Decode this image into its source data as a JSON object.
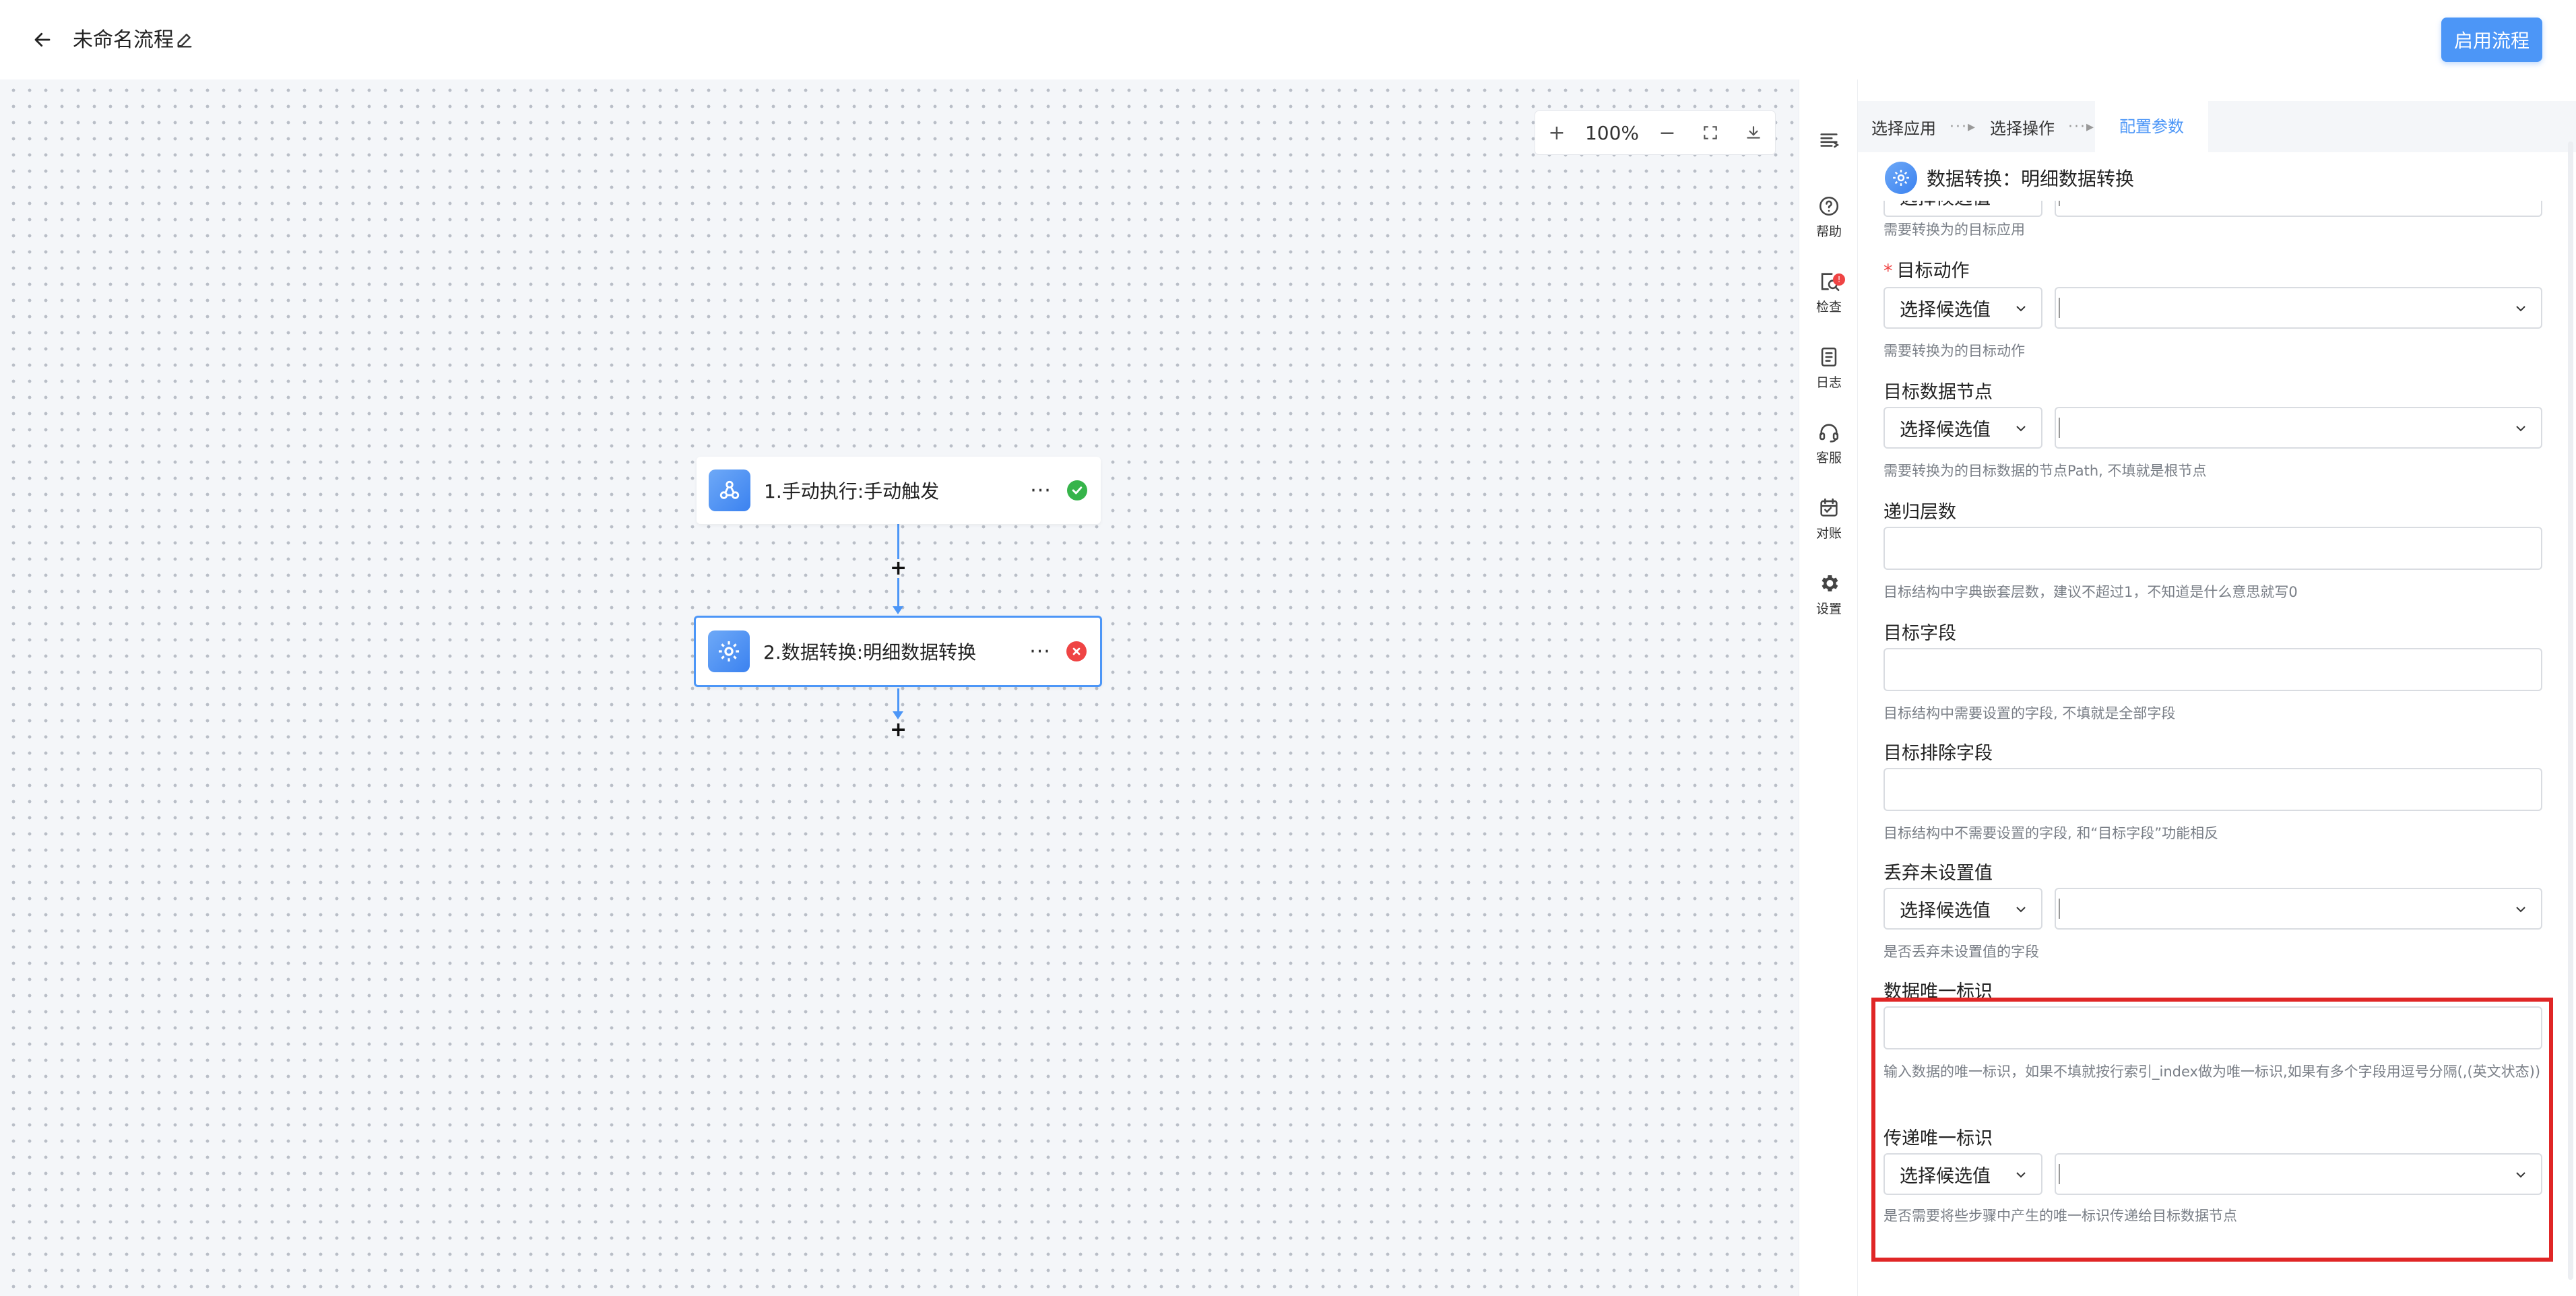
{
  "header": {
    "title": "未命名流程",
    "enable_button": "启用流程"
  },
  "canvas": {
    "zoom": "100%",
    "zoom_in": "+",
    "zoom_out": "−",
    "nodes": [
      {
        "label": "1.手动执行:手动触发",
        "more": "···",
        "status": "success"
      },
      {
        "label": "2.数据转换:明细数据转换",
        "more": "···",
        "status": "error"
      }
    ],
    "add_step": "+"
  },
  "rail": {
    "items": [
      {
        "label": "",
        "icon": "menu-icon"
      },
      {
        "label": "帮助",
        "icon": "help-icon"
      },
      {
        "label": "检查",
        "icon": "check-icon",
        "badge": "!"
      },
      {
        "label": "日志",
        "icon": "log-icon"
      },
      {
        "label": "客服",
        "icon": "headset-icon"
      },
      {
        "label": "对账",
        "icon": "calendar-icon"
      },
      {
        "label": "设置",
        "icon": "gear-icon"
      }
    ]
  },
  "panel": {
    "steps": [
      "选择应用",
      "选择操作",
      "配置参数"
    ],
    "step_separator": "···▸",
    "title": "数据转换：明细数据转换",
    "select_placeholder": "选择候选值",
    "fields": [
      {
        "hint": "需要转换为的目标应用"
      },
      {
        "label": "目标动作",
        "required": true,
        "hint": "需要转换为的目标动作"
      },
      {
        "label": "目标数据节点",
        "hint": "需要转换为的目标数据的节点Path, 不填就是根节点"
      },
      {
        "label": "递归层数",
        "hint": "目标结构中字典嵌套层数，建议不超过1，不知道是什么意思就写0"
      },
      {
        "label": "目标字段",
        "hint": "目标结构中需要设置的字段, 不填就是全部字段"
      },
      {
        "label": "目标排除字段",
        "hint": "目标结构中不需要设置的字段, 和“目标字段”功能相反"
      },
      {
        "label": "丢弃未设置值",
        "hint": "是否丢弃未设置值的字段"
      },
      {
        "label": "数据唯一标识",
        "hint": "输入数据的唯一标识，如果不填就按行索引_index做为唯一标识,如果有多个字段用逗号分隔(,(英文状态))"
      },
      {
        "label": "传递唯一标识",
        "hint": "是否需要将些步骤中产生的唯一标识传递给目标数据节点"
      }
    ]
  },
  "colors": {
    "accent": "#4c96f7",
    "success": "#36b44a",
    "error": "#ef4444",
    "highlight": "#e02626"
  }
}
